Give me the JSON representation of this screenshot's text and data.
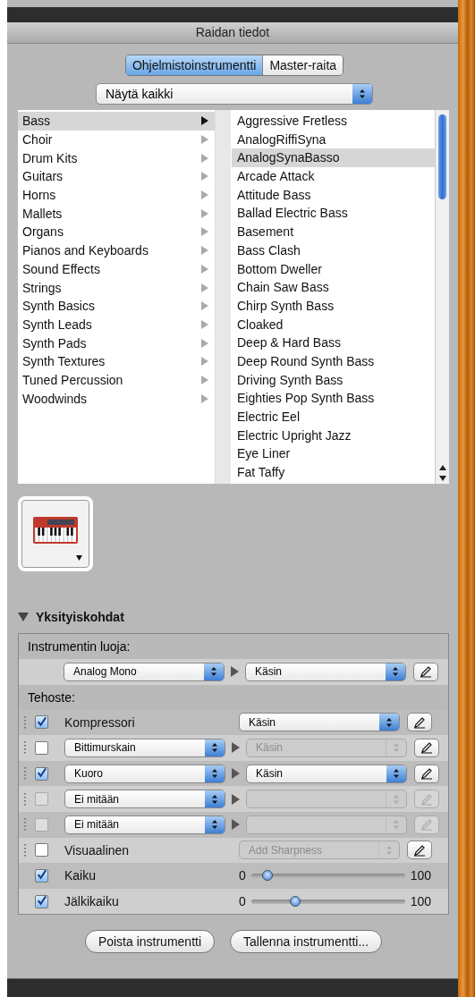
{
  "window": {
    "title": "Raidan tiedot"
  },
  "tabs": [
    {
      "label": "Ohjelmistoinstrumentti",
      "selected": true
    },
    {
      "label": "Master-raita",
      "selected": false
    }
  ],
  "filter": {
    "value": "Näytä kaikki"
  },
  "categories": [
    {
      "label": "Bass",
      "selected": true
    },
    {
      "label": "Choir",
      "selected": false
    },
    {
      "label": "Drum Kits",
      "selected": false
    },
    {
      "label": "Guitars",
      "selected": false
    },
    {
      "label": "Horns",
      "selected": false
    },
    {
      "label": "Mallets",
      "selected": false
    },
    {
      "label": "Organs",
      "selected": false
    },
    {
      "label": "Pianos and Keyboards",
      "selected": false
    },
    {
      "label": "Sound Effects",
      "selected": false
    },
    {
      "label": "Strings",
      "selected": false
    },
    {
      "label": "Synth Basics",
      "selected": false
    },
    {
      "label": "Synth Leads",
      "selected": false
    },
    {
      "label": "Synth Pads",
      "selected": false
    },
    {
      "label": "Synth Textures",
      "selected": false
    },
    {
      "label": "Tuned Percussion",
      "selected": false
    },
    {
      "label": "Woodwinds",
      "selected": false
    }
  ],
  "patches": [
    {
      "label": "Aggressive Fretless",
      "selected": false
    },
    {
      "label": "AnalogRiffiSyna",
      "selected": false
    },
    {
      "label": "AnalogSynaBasso",
      "selected": true
    },
    {
      "label": "Arcade Attack",
      "selected": false
    },
    {
      "label": "Attitude Bass",
      "selected": false
    },
    {
      "label": "Ballad Electric Bass",
      "selected": false
    },
    {
      "label": "Basement",
      "selected": false
    },
    {
      "label": "Bass Clash",
      "selected": false
    },
    {
      "label": "Bottom Dweller",
      "selected": false
    },
    {
      "label": "Chain Saw Bass",
      "selected": false
    },
    {
      "label": "Chirp Synth Bass",
      "selected": false
    },
    {
      "label": "Cloaked",
      "selected": false
    },
    {
      "label": "Deep & Hard Bass",
      "selected": false
    },
    {
      "label": "Deep Round Synth Bass",
      "selected": false
    },
    {
      "label": "Driving Synth Bass",
      "selected": false
    },
    {
      "label": "Eighties Pop Synth Bass",
      "selected": false
    },
    {
      "label": "Electric Eel",
      "selected": false
    },
    {
      "label": "Electric Upright Jazz",
      "selected": false
    },
    {
      "label": "Eye Liner",
      "selected": false
    },
    {
      "label": "Fat Taffy",
      "selected": false
    }
  ],
  "details": {
    "title": "Yksityiskohdat",
    "expanded": true,
    "creator_label": "Instrumentin luoja:",
    "creator": {
      "generator": "Analog Mono",
      "preset": "Käsin"
    },
    "effects_label": "Tehoste:",
    "effects": [
      {
        "kind": "fixed",
        "checked": true,
        "checkbox_disabled": false,
        "name": "Kompressori",
        "preset": {
          "value": "Käsin",
          "disabled": false
        },
        "edit_disabled": false
      },
      {
        "kind": "choice",
        "checked": false,
        "checkbox_disabled": false,
        "name": "Bittimurskain",
        "preset": {
          "value": "Käsin",
          "disabled": true
        },
        "edit_disabled": false
      },
      {
        "kind": "choice",
        "checked": true,
        "checkbox_disabled": false,
        "name": "Kuoro",
        "preset": {
          "value": "Käsin",
          "disabled": false
        },
        "edit_disabled": false
      },
      {
        "kind": "choice",
        "checked": false,
        "checkbox_disabled": true,
        "name": "Ei mitään",
        "preset": {
          "disabled": true
        },
        "edit_disabled": true
      },
      {
        "kind": "choice",
        "checked": false,
        "checkbox_disabled": true,
        "name": "Ei mitään",
        "preset": {
          "disabled": true
        },
        "edit_disabled": true
      },
      {
        "kind": "fixed",
        "checked": false,
        "checkbox_disabled": false,
        "name": "Visuaalinen",
        "preset": {
          "value": "Add Sharpness",
          "disabled": true
        },
        "edit_disabled": false
      },
      {
        "kind": "slider",
        "checked": true,
        "name": "Kaiku",
        "min": "0",
        "max": "100",
        "level": 0.08
      },
      {
        "kind": "slider",
        "checked": true,
        "name": "Jälkikaiku",
        "min": "0",
        "max": "100",
        "level": 0.26
      }
    ]
  },
  "buttons": [
    {
      "label": "Poista instrumentti"
    },
    {
      "label": "Tallenna instrumentti..."
    }
  ]
}
